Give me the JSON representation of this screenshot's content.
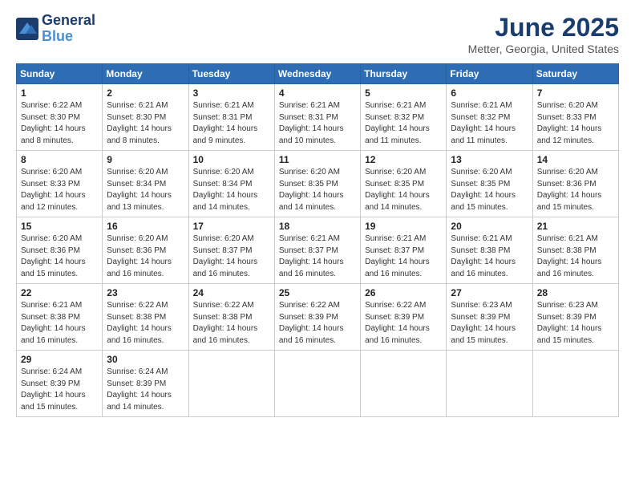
{
  "header": {
    "logo_line1": "General",
    "logo_line2": "Blue",
    "month": "June 2025",
    "location": "Metter, Georgia, United States"
  },
  "weekdays": [
    "Sunday",
    "Monday",
    "Tuesday",
    "Wednesday",
    "Thursday",
    "Friday",
    "Saturday"
  ],
  "weeks": [
    [
      {
        "day": "1",
        "sunrise": "6:22 AM",
        "sunset": "8:30 PM",
        "daylight": "14 hours and 8 minutes."
      },
      {
        "day": "2",
        "sunrise": "6:21 AM",
        "sunset": "8:30 PM",
        "daylight": "14 hours and 8 minutes."
      },
      {
        "day": "3",
        "sunrise": "6:21 AM",
        "sunset": "8:31 PM",
        "daylight": "14 hours and 9 minutes."
      },
      {
        "day": "4",
        "sunrise": "6:21 AM",
        "sunset": "8:31 PM",
        "daylight": "14 hours and 10 minutes."
      },
      {
        "day": "5",
        "sunrise": "6:21 AM",
        "sunset": "8:32 PM",
        "daylight": "14 hours and 11 minutes."
      },
      {
        "day": "6",
        "sunrise": "6:21 AM",
        "sunset": "8:32 PM",
        "daylight": "14 hours and 11 minutes."
      },
      {
        "day": "7",
        "sunrise": "6:20 AM",
        "sunset": "8:33 PM",
        "daylight": "14 hours and 12 minutes."
      }
    ],
    [
      {
        "day": "8",
        "sunrise": "6:20 AM",
        "sunset": "8:33 PM",
        "daylight": "14 hours and 12 minutes."
      },
      {
        "day": "9",
        "sunrise": "6:20 AM",
        "sunset": "8:34 PM",
        "daylight": "14 hours and 13 minutes."
      },
      {
        "day": "10",
        "sunrise": "6:20 AM",
        "sunset": "8:34 PM",
        "daylight": "14 hours and 14 minutes."
      },
      {
        "day": "11",
        "sunrise": "6:20 AM",
        "sunset": "8:35 PM",
        "daylight": "14 hours and 14 minutes."
      },
      {
        "day": "12",
        "sunrise": "6:20 AM",
        "sunset": "8:35 PM",
        "daylight": "14 hours and 14 minutes."
      },
      {
        "day": "13",
        "sunrise": "6:20 AM",
        "sunset": "8:35 PM",
        "daylight": "14 hours and 15 minutes."
      },
      {
        "day": "14",
        "sunrise": "6:20 AM",
        "sunset": "8:36 PM",
        "daylight": "14 hours and 15 minutes."
      }
    ],
    [
      {
        "day": "15",
        "sunrise": "6:20 AM",
        "sunset": "8:36 PM",
        "daylight": "14 hours and 15 minutes."
      },
      {
        "day": "16",
        "sunrise": "6:20 AM",
        "sunset": "8:36 PM",
        "daylight": "14 hours and 16 minutes."
      },
      {
        "day": "17",
        "sunrise": "6:20 AM",
        "sunset": "8:37 PM",
        "daylight": "14 hours and 16 minutes."
      },
      {
        "day": "18",
        "sunrise": "6:21 AM",
        "sunset": "8:37 PM",
        "daylight": "14 hours and 16 minutes."
      },
      {
        "day": "19",
        "sunrise": "6:21 AM",
        "sunset": "8:37 PM",
        "daylight": "14 hours and 16 minutes."
      },
      {
        "day": "20",
        "sunrise": "6:21 AM",
        "sunset": "8:38 PM",
        "daylight": "14 hours and 16 minutes."
      },
      {
        "day": "21",
        "sunrise": "6:21 AM",
        "sunset": "8:38 PM",
        "daylight": "14 hours and 16 minutes."
      }
    ],
    [
      {
        "day": "22",
        "sunrise": "6:21 AM",
        "sunset": "8:38 PM",
        "daylight": "14 hours and 16 minutes."
      },
      {
        "day": "23",
        "sunrise": "6:22 AM",
        "sunset": "8:38 PM",
        "daylight": "14 hours and 16 minutes."
      },
      {
        "day": "24",
        "sunrise": "6:22 AM",
        "sunset": "8:38 PM",
        "daylight": "14 hours and 16 minutes."
      },
      {
        "day": "25",
        "sunrise": "6:22 AM",
        "sunset": "8:39 PM",
        "daylight": "14 hours and 16 minutes."
      },
      {
        "day": "26",
        "sunrise": "6:22 AM",
        "sunset": "8:39 PM",
        "daylight": "14 hours and 16 minutes."
      },
      {
        "day": "27",
        "sunrise": "6:23 AM",
        "sunset": "8:39 PM",
        "daylight": "14 hours and 15 minutes."
      },
      {
        "day": "28",
        "sunrise": "6:23 AM",
        "sunset": "8:39 PM",
        "daylight": "14 hours and 15 minutes."
      }
    ],
    [
      {
        "day": "29",
        "sunrise": "6:24 AM",
        "sunset": "8:39 PM",
        "daylight": "14 hours and 15 minutes."
      },
      {
        "day": "30",
        "sunrise": "6:24 AM",
        "sunset": "8:39 PM",
        "daylight": "14 hours and 14 minutes."
      },
      null,
      null,
      null,
      null,
      null
    ]
  ],
  "labels": {
    "sunrise": "Sunrise:",
    "sunset": "Sunset:",
    "daylight": "Daylight:"
  }
}
